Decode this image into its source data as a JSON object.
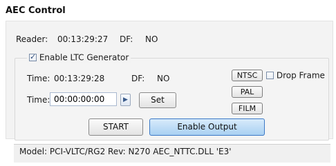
{
  "window": {
    "title": "AEC Control"
  },
  "reader": {
    "label": "Reader:",
    "time": "00:13:29:27",
    "df_label": "DF:",
    "df_value": "NO"
  },
  "generator": {
    "enable_label": "Enable LTC Generator",
    "enable_checked": true,
    "time_label": "Time:",
    "time_value": "00:13:29:28",
    "df_label": "DF:",
    "df_value": "NO",
    "input_label": "Time:",
    "input_value": "00:00:00:00",
    "set_label": "Set",
    "arrow_icon": "triangle-right-icon",
    "format_buttons": [
      "NTSC",
      "PAL",
      "FILM"
    ],
    "drop_frame_label": "Drop Frame",
    "drop_frame_checked": false,
    "start_label": "START",
    "enable_output_label": "Enable Output"
  },
  "status": {
    "text": "Model: PCI-VLTC/RG2 Rev: N270 AEC_NTTC.DLL 'E3'"
  },
  "colors": {
    "primary_button": "#a9d0f2",
    "primary_border": "#3b78c6"
  }
}
